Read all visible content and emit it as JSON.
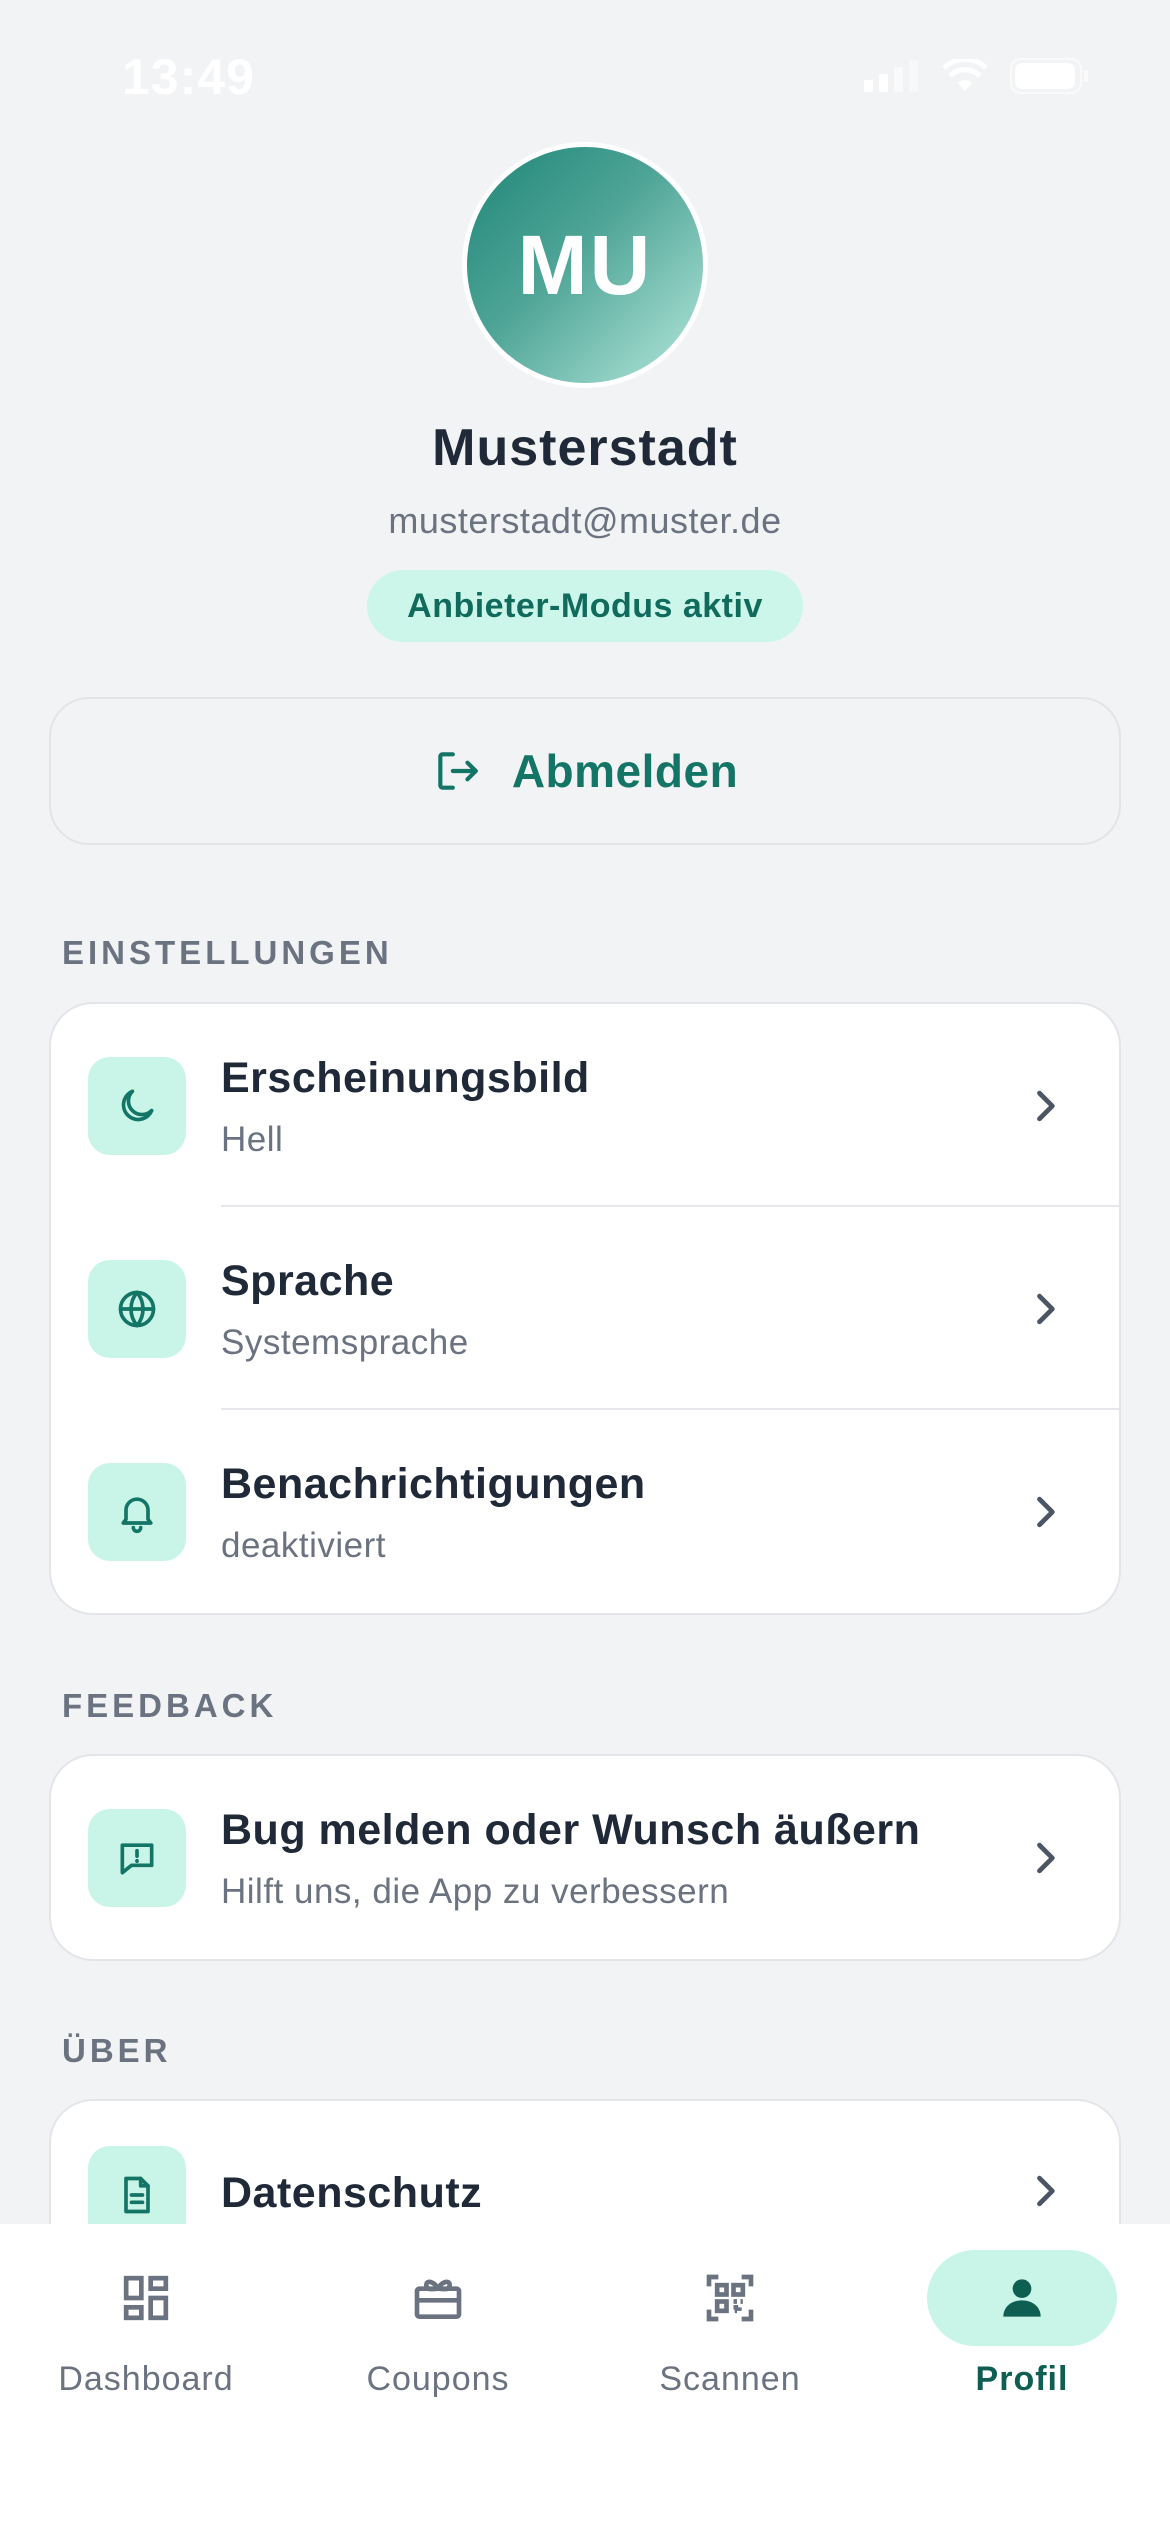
{
  "status_bar": {
    "time": "13:49"
  },
  "profile": {
    "initials": "MU",
    "name": "Musterstadt",
    "email": "musterstadt@muster.de",
    "mode_badge": "Anbieter-Modus aktiv"
  },
  "logout": {
    "label": "Abmelden"
  },
  "sections": {
    "settings": {
      "title": "EINSTELLUNGEN",
      "items": [
        {
          "title": "Erscheinungsbild",
          "subtitle": "Hell",
          "icon": "moon-icon"
        },
        {
          "title": "Sprache",
          "subtitle": "Systemsprache",
          "icon": "globe-icon"
        },
        {
          "title": "Benachrichtigungen",
          "subtitle": "deaktiviert",
          "icon": "bell-icon"
        }
      ]
    },
    "feedback": {
      "title": "FEEDBACK",
      "items": [
        {
          "title": "Bug melden oder Wunsch äußern",
          "subtitle": "Hilft uns, die App zu verbessern",
          "icon": "message-alert-icon"
        }
      ]
    },
    "about": {
      "title": "ÜBER",
      "items": [
        {
          "title": "Datenschutz",
          "icon": "document-icon"
        }
      ]
    }
  },
  "tabbar": {
    "tabs": [
      {
        "label": "Dashboard",
        "icon": "dashboard-icon",
        "active": false
      },
      {
        "label": "Coupons",
        "icon": "gift-icon",
        "active": false
      },
      {
        "label": "Scannen",
        "icon": "qr-code-icon",
        "active": false
      },
      {
        "label": "Profil",
        "icon": "person-icon",
        "active": true
      }
    ]
  },
  "colors": {
    "accent": "#137566",
    "accent_light": "#c9f5e9",
    "background": "#f2f3f5"
  }
}
